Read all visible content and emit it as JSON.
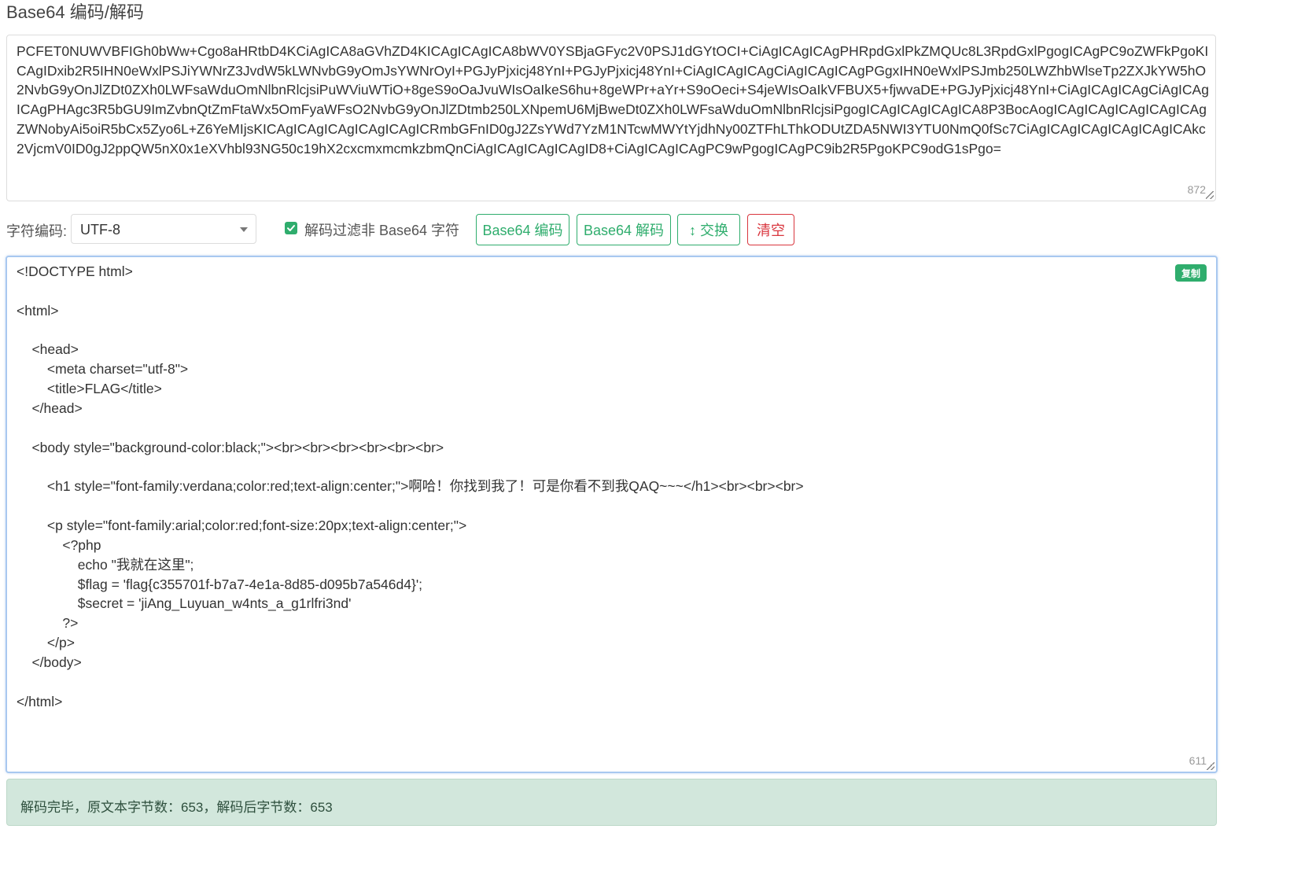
{
  "page_title": "Base64 编码/解码",
  "input": {
    "text": "PCFET0NUWVBFIGh0bWw+Cgo8aHRtbD4KCiAgICA8aGVhZD4KICAgICAgICA8bWV0YSBjaGFyc2V0PSJ1dGYtOCI+CiAgICAgICAgPHRpdGxlPkZMQUc8L3RpdGxlPgogICAgPC9oZWFkPgoKICAgIDxib2R5IHN0eWxlPSJiYWNrZ3JvdW5kLWNvbG9yOmJsYWNrOyI+PGJyPjxicj48YnI+PGJyPjxicj48YnI+CiAgICAgICAgCiAgICAgICAgPGgxIHN0eWxlPSJmb250LWZhbWlseTp2ZXJkYW5hO2NvbG9yOnJlZDt0ZXh0LWFsaWduOmNlbnRlcjsiPuWViuWTiO+8geS9oOaJvuWIsOaIkeS6hu+8geWPr+aYr+S9oOeci+S4jeWIsOaIkVFBUX5+fjwvaDE+PGJyPjxicj48YnI+CiAgICAgICAgCiAgICAgICAgPHAgc3R5bGU9ImZvbnQtZmFtaWx5OmFyaWFsO2NvbG9yOnJlZDtmb250LXNpemU6MjBweDt0ZXh0LWFsaWduOmNlbnRlcjsiPgogICAgICAgICAgICA8P3BocAogICAgICAgICAgICAgICAgZWNobyAi5oiR5bCx5Zyo6L+Z6YeMIjsKICAgICAgICAgICAgICAgICRmbGFnID0gJ2ZsYWd7YzM1NTcwMWYtYjdhNy00ZTFhLThkODUtZDA5NWI3YTU0NmQ0fSc7CiAgICAgICAgICAgICAgICAkc2VjcmV0ID0gJ2ppQW5nX0x1eXVhbl93NG50c19hX2cxcmxmcmkzbmQnCiAgICAgICAgICAgID8+CiAgICAgICAgPC9wPgogICAgPC9ib2R5PgoKPC9odG1sPgo=",
    "count": "872"
  },
  "controls": {
    "encoding_label": "字符编码:",
    "encoding_value": "UTF-8",
    "filter_label": "解码过滤非 Base64 字符",
    "filter_checked": true,
    "encode_button": "Base64 编码",
    "decode_button": "Base64 解码",
    "swap_button": "↕ 交换",
    "clear_button": "清空"
  },
  "output": {
    "copy_label": "复制",
    "count": "611",
    "text": "<!DOCTYPE html>\n\n<html>\n\n    <head>\n        <meta charset=\"utf-8\">\n        <title>FLAG</title>\n    </head>\n\n    <body style=\"background-color:black;\"><br><br><br><br><br><br>\n\n        <h1 style=\"font-family:verdana;color:red;text-align:center;\">啊哈！你找到我了！可是你看不到我QAQ~~~</h1><br><br><br>\n\n        <p style=\"font-family:arial;color:red;font-size:20px;text-align:center;\">\n            <?php\n                echo \"我就在这里\";\n                $flag = 'flag{c355701f-b7a7-4e1a-8d85-d095b7a546d4}';\n                $secret = 'jiAng_Luyuan_w4nts_a_g1rlfri3nd'\n            ?>\n        </p>\n    </body>\n\n</html>"
  },
  "status": {
    "text": "解码完毕，原文本字节数：653，解码后字节数：653"
  },
  "colors": {
    "accent": "#2fad6d",
    "danger": "#d9363e",
    "status_bg": "#d2e7dc",
    "focus_border": "#a8c8f0"
  }
}
